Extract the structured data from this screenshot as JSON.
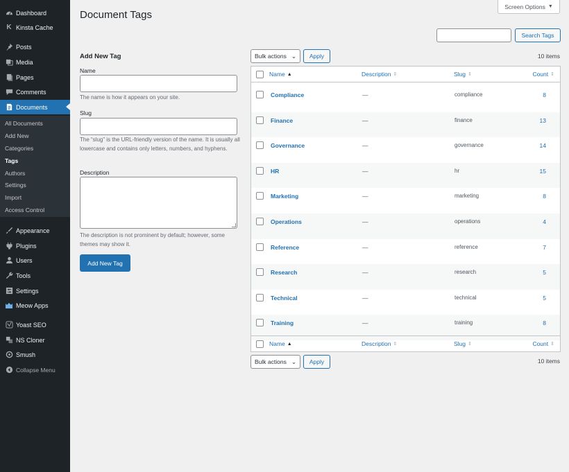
{
  "sidebar": {
    "items": [
      {
        "label": "Dashboard",
        "icon": "dashboard-icon"
      },
      {
        "label": "Kinsta Cache",
        "icon": "kinsta-icon"
      },
      {
        "label": "Posts",
        "icon": "pin-icon"
      },
      {
        "label": "Media",
        "icon": "media-icon"
      },
      {
        "label": "Pages",
        "icon": "pages-icon"
      },
      {
        "label": "Comments",
        "icon": "comments-icon"
      },
      {
        "label": "Documents",
        "icon": "document-icon"
      },
      {
        "label": "Appearance",
        "icon": "brush-icon"
      },
      {
        "label": "Plugins",
        "icon": "plug-icon"
      },
      {
        "label": "Users",
        "icon": "user-icon"
      },
      {
        "label": "Tools",
        "icon": "wrench-icon"
      },
      {
        "label": "Settings",
        "icon": "settings-icon"
      },
      {
        "label": "Meow Apps",
        "icon": "meow-icon"
      },
      {
        "label": "Yoast SEO",
        "icon": "yoast-icon"
      },
      {
        "label": "NS Cloner",
        "icon": "cloner-icon"
      },
      {
        "label": "Smush",
        "icon": "smush-icon"
      },
      {
        "label": "Collapse Menu",
        "icon": "collapse-icon"
      }
    ],
    "submenu": [
      "All Documents",
      "Add New",
      "Categories",
      "Tags",
      "Authors",
      "Settings",
      "Import",
      "Access Control"
    ]
  },
  "header": {
    "title": "Document Tags",
    "screen_options": "Screen Options",
    "search_button": "Search Tags",
    "search_value": ""
  },
  "form": {
    "heading": "Add New Tag",
    "name_label": "Name",
    "name_help": "The name is how it appears on your site.",
    "slug_label": "Slug",
    "slug_help": "The “slug” is the URL-friendly version of the name. It is usually all lowercase and contains only letters, numbers, and hyphens.",
    "description_label": "Description",
    "description_help": "The description is not prominent by default; however, some themes may show it.",
    "submit": "Add New Tag"
  },
  "table": {
    "bulk_actions": "Bulk actions",
    "apply": "Apply",
    "items_count": "10 items",
    "columns": {
      "name": "Name",
      "description": "Description",
      "slug": "Slug",
      "count": "Count"
    },
    "rows": [
      {
        "name": "Compliance",
        "description": "—",
        "slug": "compliance",
        "count": "8"
      },
      {
        "name": "Finance",
        "description": "—",
        "slug": "finance",
        "count": "13"
      },
      {
        "name": "Governance",
        "description": "—",
        "slug": "governance",
        "count": "14"
      },
      {
        "name": "HR",
        "description": "—",
        "slug": "hr",
        "count": "15"
      },
      {
        "name": "Marketing",
        "description": "—",
        "slug": "marketing",
        "count": "8"
      },
      {
        "name": "Operations",
        "description": "—",
        "slug": "operations",
        "count": "4"
      },
      {
        "name": "Reference",
        "description": "—",
        "slug": "reference",
        "count": "7"
      },
      {
        "name": "Research",
        "description": "—",
        "slug": "research",
        "count": "5"
      },
      {
        "name": "Technical",
        "description": "—",
        "slug": "technical",
        "count": "5"
      },
      {
        "name": "Training",
        "description": "—",
        "slug": "training",
        "count": "8"
      }
    ]
  },
  "colors": {
    "accent": "#2271b1",
    "sidebar": "#1d2327",
    "submenu": "#2c3338"
  }
}
